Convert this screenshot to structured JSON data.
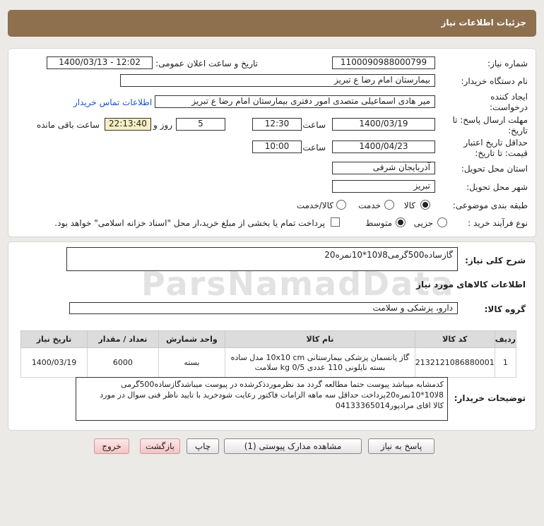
{
  "header": {
    "title": "جزئیات اطلاعات نیاز"
  },
  "form": {
    "need_number_label": "شماره نیاز:",
    "need_number": "1100090988000799",
    "announce_label": "تاریخ و ساعت اعلان عمومی:",
    "announce_value": "1400/03/13 - 12:02",
    "buyer_org_label": "نام دستگاه خریدار:",
    "buyer_org": "بیمارستان امام رضا  ع  تبریز",
    "creator_label": "ایجاد کننده درخواست:",
    "creator": "میر هادی  اسماعیلی متصدی امور دفتری بیمارستان امام رضا  ع  تبریز",
    "buyer_contact_link": "اطلاعات تماس خریدار",
    "reply_deadline_label": "مهلت ارسال پاسخ: تا تاریخ:",
    "reply_date": "1400/03/19",
    "time_label": "ساعت",
    "reply_time": "12:30",
    "days_value": "5",
    "days_label": "روز و",
    "remaining_time": "22:13:40",
    "remaining_label": "ساعت باقی مانده",
    "price_validity_label": "حداقل تاریخ اعتبار قیمت: تا تاریخ:",
    "price_date": "1400/04/23",
    "price_time": "10:00",
    "province_label": "استان محل تحویل:",
    "province": "آذربایجان شرقی",
    "city_label": "شهر محل تحویل:",
    "city": "تبریز",
    "category_label": "طبقه بندی موضوعی:",
    "category_options": [
      "کالا",
      "خدمت",
      "کالا/خدمت"
    ],
    "process_label": "نوع فرآیند خرید :",
    "process_options": [
      "جزیی",
      "متوسط"
    ],
    "payment_note": "پرداخت تمام یا بخشی از مبلغ خرید،از محل \"اسناد خزانه اسلامی\" خواهد بود."
  },
  "summary": {
    "label": "شرح کلی نیاز:",
    "value": "گازساده500گرمی8لا10*10نمره20"
  },
  "goods": {
    "section_title": "اطلاعات کالاهای مورد نیاز",
    "group_label": "گروه کالا:",
    "group_value": "دارو، پزشکی و سلامت",
    "columns": [
      "ردیف",
      "کد کالا",
      "نام کالا",
      "واحد شمارش",
      "تعداد / مقدار",
      "تاریخ نیاز"
    ],
    "rows": [
      {
        "row": "1",
        "code": "2132121086880001",
        "name_line1": "گاز پانسمان پزشکی بیمارستانی 10x10 cm مدل ساده",
        "name_line2": "بسته نایلونی 110 عددی 0/5 kg سلامت",
        "unit": "بسته",
        "qty": "6000",
        "date": "1400/03/19"
      }
    ]
  },
  "buyer_notes": {
    "label": "توضیحات خریدار:",
    "lines": [
      "کدمشابه میباشد پیوست حتما مطالعه گردد مد نظرموردذکرشده در پیوست میباشدگازساده500گرمی",
      "8لا10*10نمره20پرداخت حداقل سه ماهه الزامات فاکتور رعایت شودخرید با تایید ناظر فنی سوال در مورد",
      "کالا اقای مرادپور04133365014"
    ]
  },
  "watermark": {
    "text": "ParsNamadData"
  },
  "buttons": {
    "reply": "پاسخ به نیاز",
    "attachments": "مشاهده مدارک پیوستی (1)",
    "print": "چاپ",
    "back": "بازگشت",
    "exit": "خروج"
  }
}
